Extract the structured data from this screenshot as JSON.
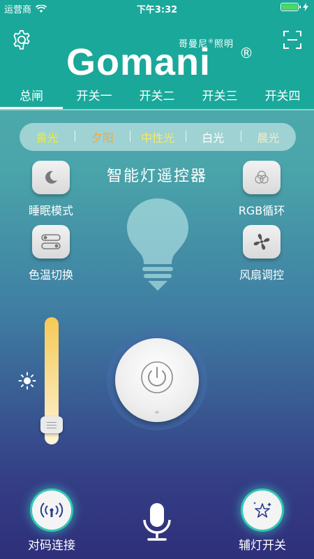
{
  "status_bar": {
    "carrier": "运营商",
    "time": "下午3:32",
    "battery_percent": 100
  },
  "header": {
    "logo_subtitle": "哥曼尼",
    "logo_subtitle_suffix": "照明",
    "logo_text": "Gomani",
    "logo_reg": "®"
  },
  "tabs": [
    {
      "label": "总闸",
      "active": true
    },
    {
      "label": "开关一",
      "active": false
    },
    {
      "label": "开关二",
      "active": false
    },
    {
      "label": "开关三",
      "active": false
    },
    {
      "label": "开关四",
      "active": false
    }
  ],
  "modes": [
    {
      "label": "黄光",
      "color": "#f4ea2a"
    },
    {
      "label": "夕阳",
      "color": "#f0a93c"
    },
    {
      "label": "中性光",
      "color": "#f6e867"
    },
    {
      "label": "白光",
      "color": "#ffffff"
    },
    {
      "label": "晨光",
      "color": "#f8ecc5"
    }
  ],
  "title": "智能灯遥控器",
  "left_buttons": [
    {
      "label": "睡眠模式",
      "icon": "moon-icon"
    },
    {
      "label": "色温切换",
      "icon": "toggle-switch-icon"
    }
  ],
  "right_buttons": [
    {
      "label": "RGB循环",
      "icon": "rgb-cycle-icon"
    },
    {
      "label": "风扇调控",
      "icon": "fan-icon"
    }
  ],
  "brightness": {
    "level": 0.1,
    "icon": "sun-icon"
  },
  "power": {
    "icon": "power-icon"
  },
  "bottom": {
    "left_label": "对码连接",
    "left_icon": "signal-pair-icon",
    "center_icon": "microphone-icon",
    "right_label": "辅灯开关",
    "right_icon": "star-lamp-icon"
  },
  "colors": {
    "header_bg": "#1aa89a",
    "accent_glow": "#32c7b4"
  }
}
